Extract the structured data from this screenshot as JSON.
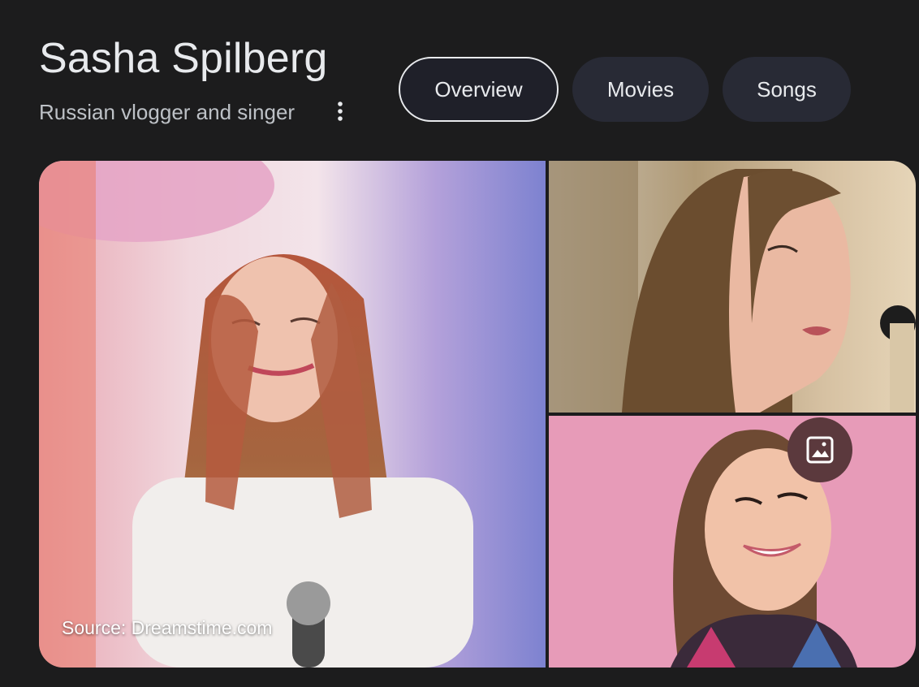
{
  "header": {
    "title": "Sasha Spilberg",
    "subtitle": "Russian vlogger and singer",
    "more_icon": "more-vert-icon"
  },
  "tabs": [
    {
      "label": "Overview",
      "active": true
    },
    {
      "label": "Movies",
      "active": false
    },
    {
      "label": "Songs",
      "active": false
    }
  ],
  "gallery": {
    "source_caption": "Source: Dreamstime.com",
    "images_button_icon": "image-icon",
    "images": [
      {
        "name": "main-photo"
      },
      {
        "name": "top-right-photo"
      },
      {
        "name": "bottom-right-photo"
      }
    ]
  },
  "colors": {
    "background": "#1c1c1d",
    "tab_bg": "#282a35",
    "text_primary": "#e8eaed",
    "text_secondary": "#bdc1c6",
    "image_button_bg": "#5b393d"
  }
}
